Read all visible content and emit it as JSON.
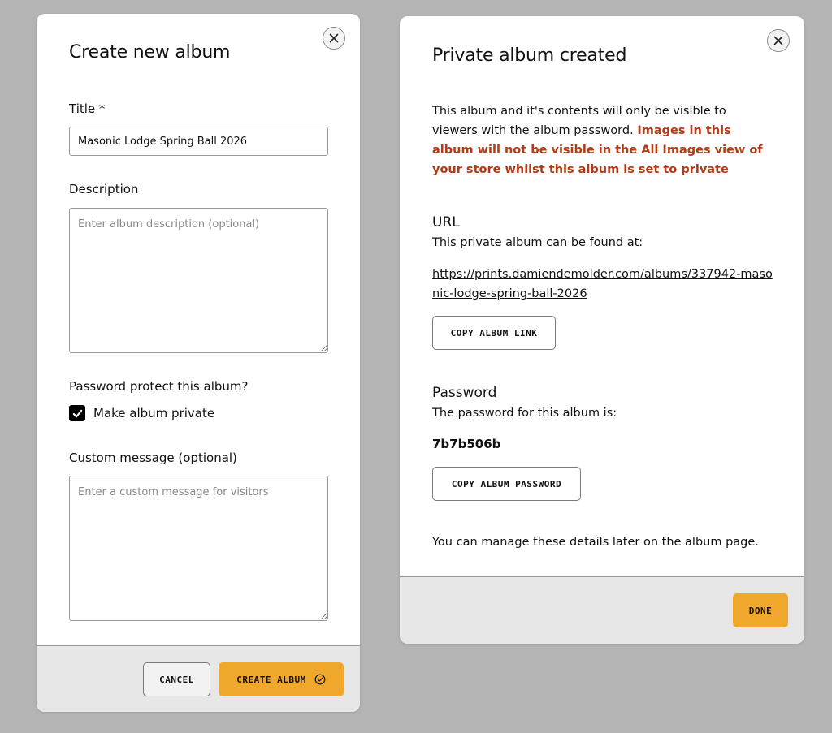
{
  "create_modal": {
    "title": "Create new album",
    "title_field": {
      "label": "Title *",
      "value": "Masonic Lodge Spring Ball 2026"
    },
    "description_field": {
      "label": "Description",
      "placeholder": "Enter album description (optional)"
    },
    "password_section": {
      "label": "Password protect this album?",
      "checkbox_label": "Make album private",
      "checked": true
    },
    "custom_message_field": {
      "label": "Custom message (optional)",
      "placeholder": "Enter a custom message for visitors"
    },
    "footer": {
      "cancel_label": "CANCEL",
      "create_label": "CREATE ALBUM"
    }
  },
  "created_modal": {
    "title": "Private album created",
    "intro_text": "This album and it's contents will only be visible to viewers with the album password. ",
    "warning_text": "Images in this album will not be visible in the All Images view of your store whilst this album is set to private",
    "url_section": {
      "heading": "URL",
      "description": "This private album can be found at:",
      "link": "https://prints.damiendemolder.com/albums/337942-masonic-lodge-spring-ball-2026",
      "copy_label": "COPY ALBUM LINK"
    },
    "password_section": {
      "heading": "Password",
      "description": "The password for this album is:",
      "value": "7b7b506b",
      "copy_label": "COPY ALBUM PASSWORD"
    },
    "manage_note": "You can manage these details later on the album page.",
    "footer": {
      "done_label": "DONE"
    }
  },
  "colors": {
    "backdrop": "#b4b4b4",
    "accent": "#f0a82c",
    "warning": "#b23a14",
    "footer_bg": "#e7e7e7"
  },
  "icons": {
    "close": "close-icon",
    "checkmark": "checkmark-icon",
    "create_check": "check-circle-icon"
  }
}
